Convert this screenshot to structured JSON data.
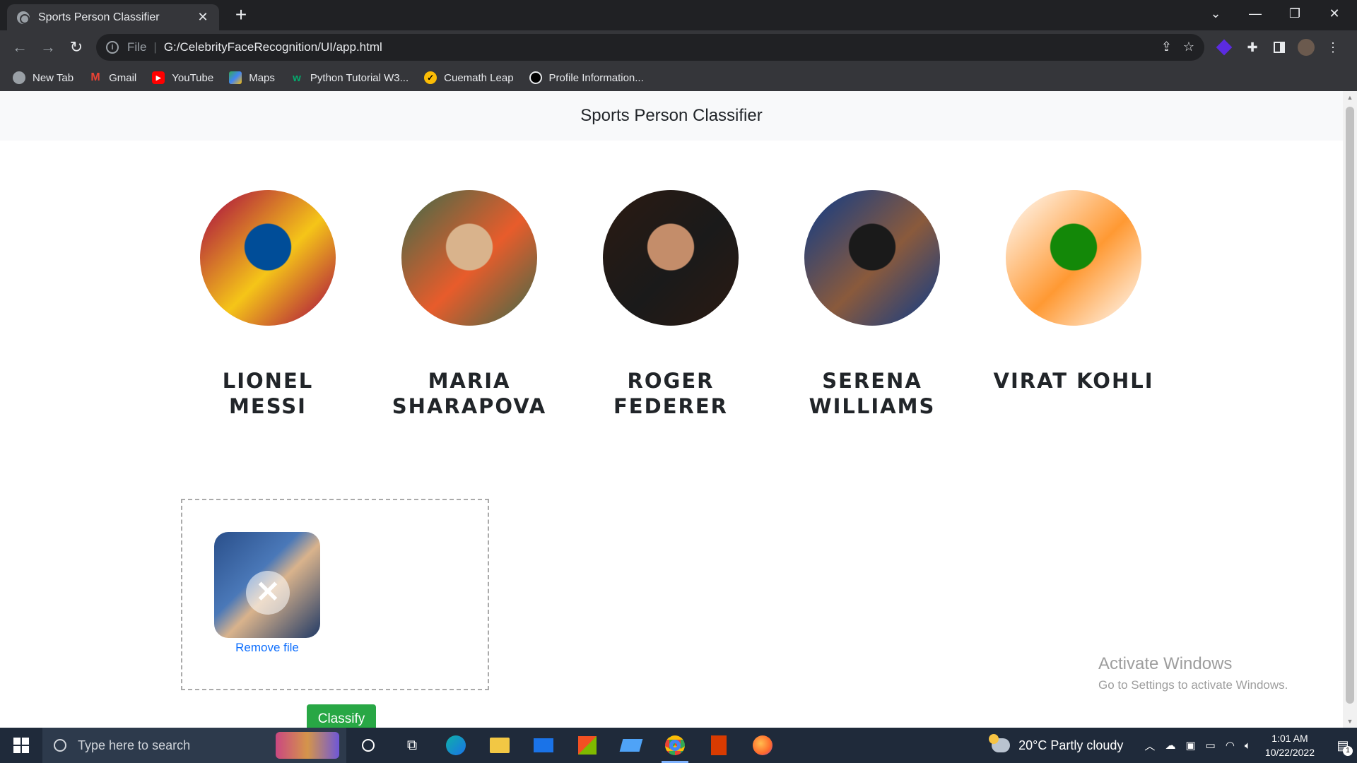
{
  "browser": {
    "tab_title": "Sports Person Classifier",
    "url_scheme": "File",
    "url": "G:/CelebrityFaceRecognition/UI/app.html",
    "bookmarks": [
      {
        "label": "New Tab",
        "icon": "globe-icon",
        "color": "#9aa0a6"
      },
      {
        "label": "Gmail",
        "icon": "gmail-icon",
        "color": "#ea4335"
      },
      {
        "label": "YouTube",
        "icon": "youtube-icon",
        "color": "#ff0000"
      },
      {
        "label": "Maps",
        "icon": "maps-icon",
        "color": "#34a853"
      },
      {
        "label": "Python Tutorial W3...",
        "icon": "w3schools-icon",
        "color": "#04aa6d"
      },
      {
        "label": "Cuemath Leap",
        "icon": "cuemath-icon",
        "color": "#fbbc05"
      },
      {
        "label": "Profile Information...",
        "icon": "profile-circle-icon",
        "color": "#000000"
      }
    ]
  },
  "page": {
    "header_title": "Sports Person Classifier",
    "players": [
      {
        "line1": "LIONEL",
        "line2": "MESSI",
        "colors": [
          "#a50044",
          "#004d98",
          "#f5c518"
        ]
      },
      {
        "line1": "MARIA",
        "line2": "SHARAPOVA",
        "colors": [
          "#3b6b4a",
          "#d9b38c",
          "#e85c2b"
        ]
      },
      {
        "line1": "ROGER",
        "line2": "FEDERER",
        "colors": [
          "#2b1a12",
          "#c48d6a",
          "#1a1a1a"
        ]
      },
      {
        "line1": "SERENA",
        "line2": "WILLIAMS",
        "colors": [
          "#0b3a8a",
          "#1a1a1a",
          "#8a5a3c"
        ]
      },
      {
        "line1": "VIRAT KOHLI",
        "line2": "",
        "colors": [
          "#ffffff",
          "#138808",
          "#ff9933"
        ]
      }
    ],
    "upload": {
      "remove_label": "Remove file",
      "remove_glyph": "✕"
    },
    "classify_label": "Classify",
    "watermark": {
      "line1": "Activate Windows",
      "line2": "Go to Settings to activate Windows."
    }
  },
  "taskbar": {
    "search_placeholder": "Type here to search",
    "apps": [
      "cortana-icon",
      "task-view-icon",
      "edge-icon",
      "file-explorer-icon",
      "mail-icon",
      "store-icon",
      "laptop-icon",
      "chrome-icon",
      "office-icon",
      "firefox-icon"
    ],
    "weather": "20°C  Partly cloudy",
    "time": "1:01 AM",
    "date": "10/22/2022",
    "notification_count": "1"
  }
}
